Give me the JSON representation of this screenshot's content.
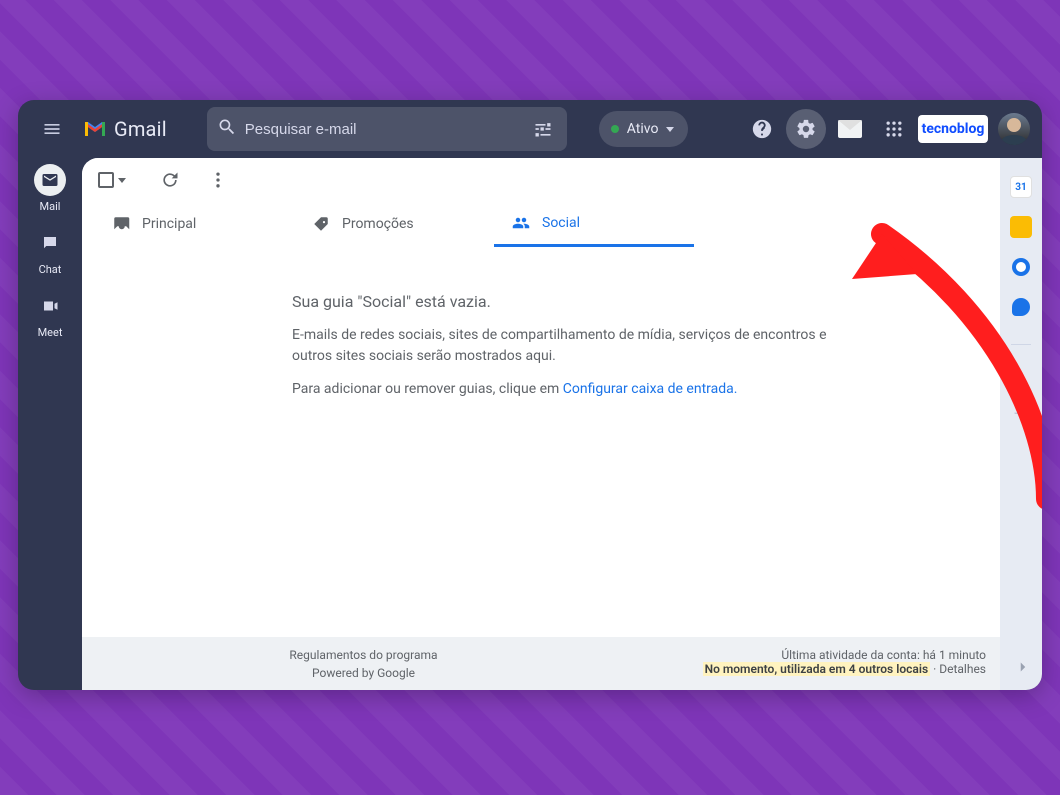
{
  "brand": {
    "name": "Gmail",
    "badge_text": "tecnoblog"
  },
  "header": {
    "search_placeholder": "Pesquisar e-mail",
    "status_label": "Ativo"
  },
  "rail": {
    "items": [
      {
        "label": "Mail"
      },
      {
        "label": "Chat"
      },
      {
        "label": "Meet"
      }
    ]
  },
  "toolbar": {},
  "tabs": {
    "items": [
      {
        "label": "Principal"
      },
      {
        "label": "Promoções"
      },
      {
        "label": "Social"
      }
    ],
    "active_index": 2
  },
  "empty_state": {
    "title": "Sua guia \"Social\" está vazia.",
    "body1": "E-mails de redes sociais, sites de compartilhamento de mídia, serviços de encontros e outros sites sociais serão mostrados aqui.",
    "body2_prefix": "Para adicionar ou remover guias, clique em ",
    "body2_link": "Configurar caixa de entrada."
  },
  "footer": {
    "rules": "Regulamentos do programa",
    "powered": "Powered by Google",
    "activity_prefix": "Última atividade da conta: há 1 minuto",
    "locations_highlight": "No momento, utilizada em 4 outros locais",
    "details_label": "Detalhes",
    "separator": " · "
  },
  "side_panel": {
    "calendar_day": "31"
  }
}
